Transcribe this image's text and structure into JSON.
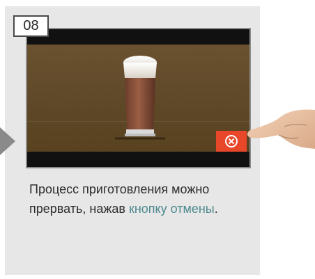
{
  "step": {
    "number": "08"
  },
  "description": {
    "text_before": "Процесс приготовления можно прервать, нажав ",
    "link_text": "кнопку отмены",
    "text_after": "."
  },
  "icons": {
    "arrow": "left-arrow-triangle-icon",
    "cancel": "cancel-x-icon",
    "hand": "hand-pointer-icon",
    "drink": "latte-macchiato-glass-icon"
  },
  "colors": {
    "card_background": "#e7e7e7",
    "display_background": "#5f4828",
    "cancel_button": "#e8472a",
    "link": "#4f8a8e"
  }
}
